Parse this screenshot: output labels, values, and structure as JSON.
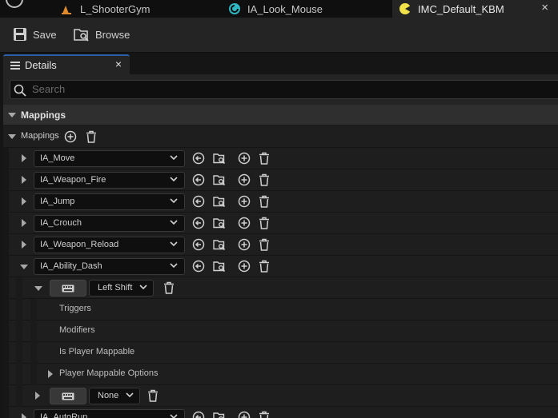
{
  "doc_tabs": [
    {
      "label": "L_ShooterGym"
    },
    {
      "label": "IA_Look_Mouse"
    },
    {
      "label": "IMC_Default_KBM"
    }
  ],
  "toolbar": {
    "save_label": "Save",
    "browse_label": "Browse"
  },
  "details": {
    "tab_label": "Details",
    "close_glyph": "×",
    "search_placeholder": "Search",
    "category": "Mappings",
    "mappings_label": "Mappings",
    "actions": [
      "IA_Move",
      "IA_Weapon_Fire",
      "IA_Jump",
      "IA_Crouch",
      "IA_Weapon_Reload",
      "IA_Ability_Dash",
      "IA_AutoRun"
    ],
    "expanded_action": {
      "key_1": "Left Shift",
      "sub_rows": [
        "Triggers",
        "Modifiers",
        "Is Player Mappable",
        "Player Mappable Options"
      ],
      "key_2": "None"
    }
  },
  "icons": {
    "tab_close": "close-icon",
    "save": "floppy-disk-icon",
    "browse": "browse-folder-icon",
    "add": "plus-circle-icon",
    "delete": "trash-icon",
    "reset": "reset-arrow-icon",
    "find": "find-in-browser-icon",
    "keyboard": "keyboard-icon"
  },
  "colors": {
    "accent": "#2a5fa8",
    "asset_tab_icon": "#2fb8c4",
    "level_tab_icon": "#e08a2c",
    "active_tab_icon": "#f2e24a"
  }
}
